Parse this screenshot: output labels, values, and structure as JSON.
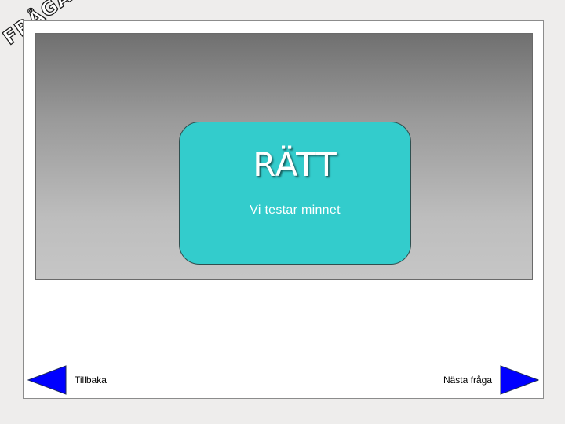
{
  "corner_title": {
    "text": "FRÅGA"
  },
  "answer": {
    "result": "RÄTT",
    "subtitle": "Vi testar minnet"
  },
  "navigation": {
    "back_label": "Tillbaka",
    "next_label": "Nästa fråga",
    "back_icon": "left-arrow-icon",
    "next_icon": "right-arrow-icon"
  },
  "colors": {
    "card": "#33cccc",
    "arrow": "#0000ff",
    "page_background": "#eeedec"
  }
}
